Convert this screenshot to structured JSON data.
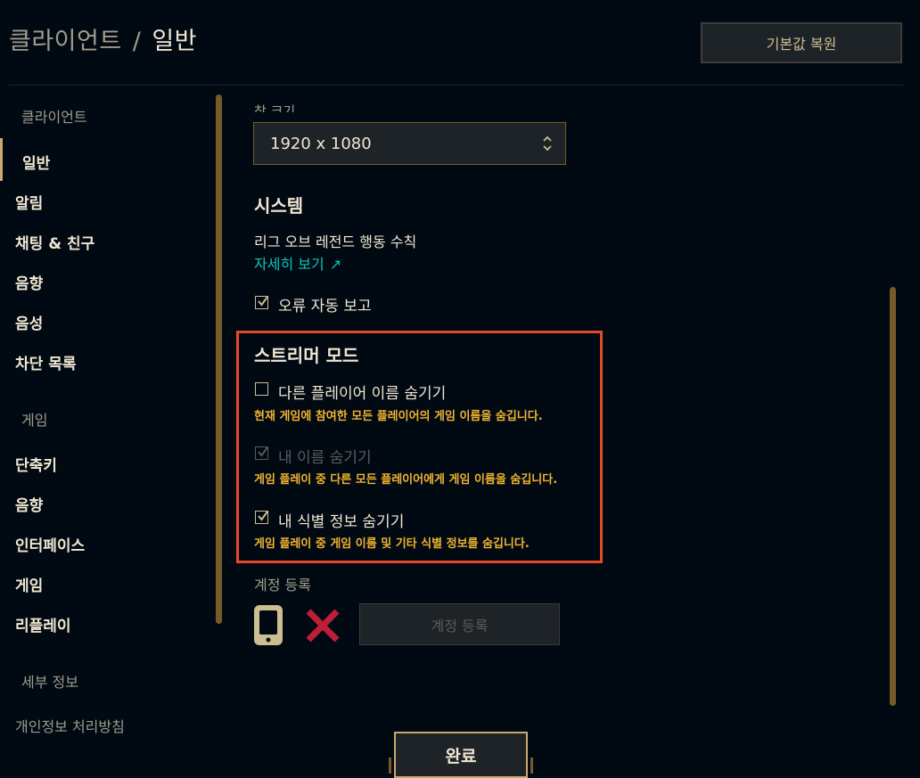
{
  "header": {
    "section": "클라이언트",
    "separator": "/",
    "current": "일반",
    "reset_label": "기본값 복원"
  },
  "sidebar": {
    "client_heading": "클라이언트",
    "client_items": [
      "일반",
      "알림",
      "채팅 & 친구",
      "음향",
      "음성",
      "차단 목록"
    ],
    "game_heading": "게임",
    "game_items": [
      "단축키",
      "음향",
      "인터페이스",
      "게임",
      "리플레이"
    ],
    "details_heading": "세부 정보",
    "details_items": [
      "개인정보 처리방침"
    ]
  },
  "content": {
    "window_size_label": "창 크기",
    "window_size_value": "1920 x 1080",
    "system_title": "시스템",
    "code_of_conduct": "리그 오브 레전드 행동 수칙",
    "learn_more": "자세히 보기",
    "error_report": {
      "label": "오류 자동 보고",
      "checked": true
    },
    "streamer_mode": {
      "title": "스트리머 모드",
      "options": [
        {
          "label": "다른 플레이어 이름 숨기기",
          "desc": "현재 게임에 참여한 모든 플레이어의 게임 이름을 숨깁니다.",
          "checked": false,
          "disabled": false
        },
        {
          "label": "내 이름 숨기기",
          "desc": "게임 플레이 중 다른 모든 플레이어에게 게임 이름을 숨깁니다.",
          "checked": true,
          "disabled": true
        },
        {
          "label": "내 식별 정보 숨기기",
          "desc": "게임 플레이 중 게임 이름 및 기타 식별 정보를 숨깁니다.",
          "checked": true,
          "disabled": false
        }
      ]
    },
    "account_reg": {
      "label": "계정 등록",
      "phone_icon": "phone-icon",
      "status_icon": "red-x-icon",
      "button_label": "계정 등록"
    }
  },
  "footer": {
    "done_label": "완료"
  },
  "colors": {
    "background": "#010a13",
    "gold": "#c8aa6e",
    "gold_dark": "#785a28",
    "text": "#f0e6d2",
    "muted": "#a09b8c",
    "link": "#0ac8b9",
    "desc": "#f0b232",
    "highlight_box": "#e8482a",
    "error_x": "#be1e37"
  }
}
